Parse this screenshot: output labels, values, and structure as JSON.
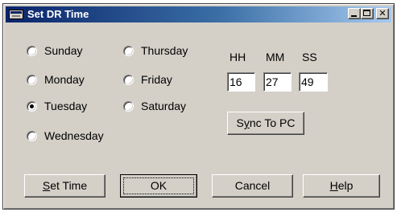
{
  "window": {
    "title": "Set DR Time"
  },
  "days": {
    "sunday": "Sunday",
    "monday": "Monday",
    "tuesday": "Tuesday",
    "wednesday": "Wednesday",
    "thursday": "Thursday",
    "friday": "Friday",
    "saturday": "Saturday",
    "selected": "Tuesday"
  },
  "time": {
    "hh_label": "HH",
    "mm_label": "MM",
    "ss_label": "SS",
    "hh": "16",
    "mm": "27",
    "ss": "49"
  },
  "buttons": {
    "sync_pre": "S",
    "sync_acc": "y",
    "sync_post": "nc To PC",
    "set_acc": "S",
    "set_post": "et Time",
    "ok": "OK",
    "cancel": "Cancel",
    "help_acc": "H",
    "help_post": "elp"
  },
  "icons": {
    "window": "app-window-icon",
    "minimize": "minimize-icon",
    "maximize": "maximize-icon",
    "close": "close-icon"
  }
}
